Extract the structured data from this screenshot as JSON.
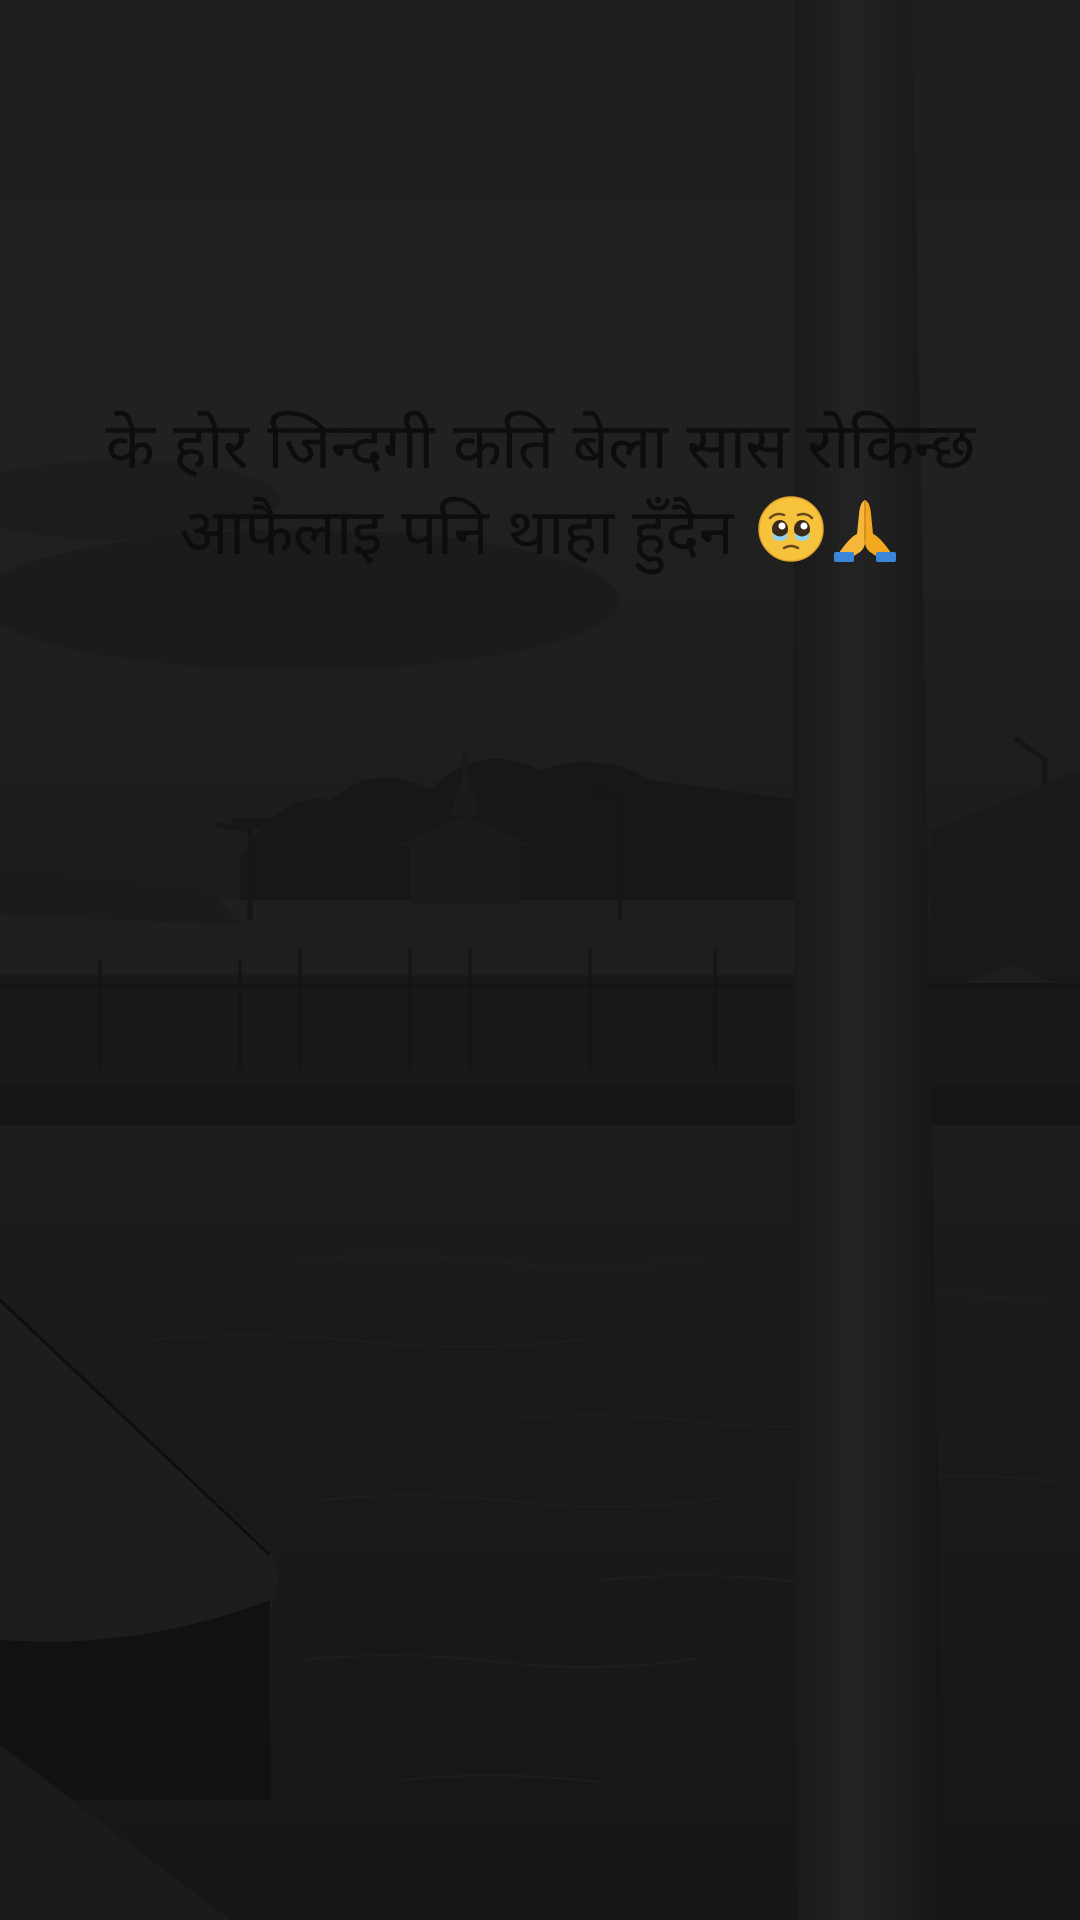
{
  "caption": {
    "line1": "के होर जिन्दगी कति बेला सास रोकिन्छ",
    "line2": "आफैलाइ पनि थाहा हुँदैन"
  },
  "emojis": [
    "pleading-face-icon",
    "folded-hands-icon"
  ],
  "colors": {
    "background": "#1c1c1b",
    "caption_text": "#0d0d0d",
    "pole": "#1f1f1f",
    "water": "#1a1a1a"
  }
}
